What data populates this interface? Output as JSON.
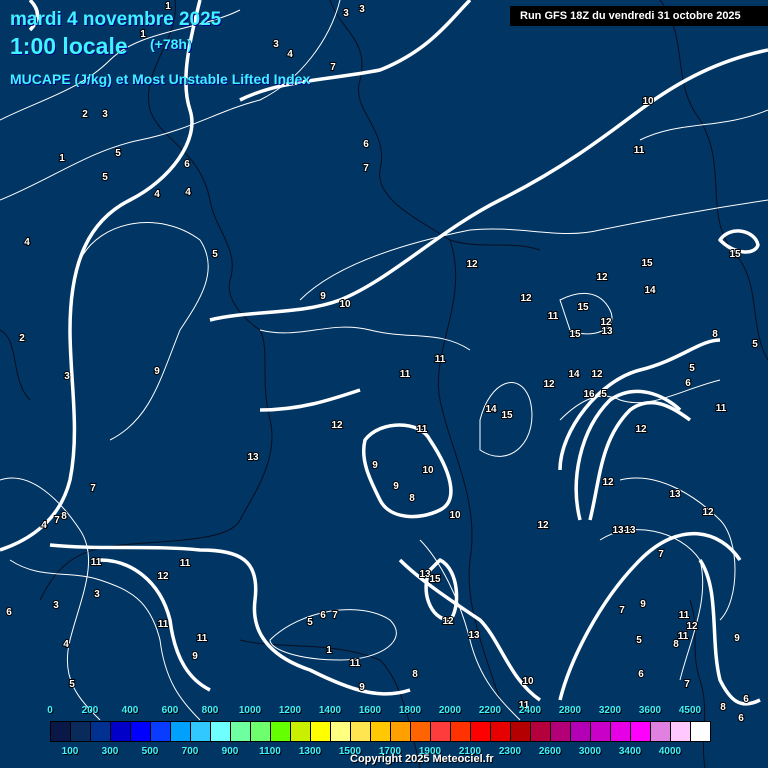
{
  "header": {
    "date": "mardi 4 novembre 2025",
    "time": "1:00 locale",
    "lead": "(+78h)",
    "parameter": "MUCAPE (J/kg) et Most Unstable Lifted Index",
    "run": "Run GFS 18Z du vendredi 31 octobre 2025"
  },
  "colors": {
    "background": "#013563",
    "contour": "#ffffff",
    "title": "#3ff4ff"
  },
  "legend": {
    "top_labels": [
      "0",
      "200",
      "400",
      "600",
      "800",
      "1000",
      "1200",
      "1400",
      "1600",
      "1800",
      "2000",
      "2200",
      "2400",
      "2800",
      "3200",
      "3600",
      "4500"
    ],
    "bottom_labels": [
      "100",
      "300",
      "500",
      "700",
      "900",
      "1100",
      "1300",
      "1500",
      "1700",
      "1900",
      "2100",
      "2300",
      "2600",
      "3000",
      "3400",
      "4000"
    ],
    "colors": [
      "#0a1848",
      "#0a2a5c",
      "#003090",
      "#0000c8",
      "#0000ff",
      "#0a3cff",
      "#00a0ff",
      "#30c8ff",
      "#6effff",
      "#6effa0",
      "#6eff6e",
      "#64ff00",
      "#c8f000",
      "#ffff00",
      "#ffff80",
      "#ffe650",
      "#ffc800",
      "#ffa000",
      "#ff6400",
      "#ff3c3c",
      "#ff3200",
      "#ff0000",
      "#e60000",
      "#b40000",
      "#b4003c",
      "#b40078",
      "#b400b4",
      "#c800c8",
      "#e600e6",
      "#ff00ff",
      "#e080e0",
      "#ffc8ff",
      "#ffffff"
    ]
  },
  "lifted_index_labels": [
    "1",
    "3",
    "3",
    "3",
    "4",
    "7",
    "1",
    "2",
    "3",
    "1",
    "5",
    "5",
    "6",
    "4",
    "4",
    "4",
    "5",
    "6",
    "7",
    "10",
    "11",
    "12",
    "12",
    "12",
    "15",
    "15",
    "14",
    "15",
    "11",
    "12",
    "15",
    "13",
    "9",
    "10",
    "2",
    "3",
    "9",
    "11",
    "11",
    "12",
    "14",
    "12",
    "14",
    "15",
    "16",
    "5",
    "8",
    "5",
    "6",
    "11",
    "12",
    "5",
    "12",
    "11",
    "13",
    "9",
    "10",
    "9",
    "8",
    "7",
    "10",
    "12",
    "13",
    "12",
    "12",
    "13",
    "13",
    "4",
    "7",
    "8",
    "11",
    "12",
    "11",
    "7",
    "13",
    "15",
    "3",
    "3",
    "6",
    "5",
    "6",
    "7",
    "11",
    "12",
    "13",
    "7",
    "9",
    "11",
    "12",
    "11",
    "11",
    "4",
    "9",
    "9",
    "5",
    "8",
    "1",
    "11",
    "6",
    "8",
    "5",
    "9",
    "10",
    "7",
    "11",
    "8",
    "6",
    "6"
  ],
  "copyright": "Copyright 2025 Meteociel.fr"
}
